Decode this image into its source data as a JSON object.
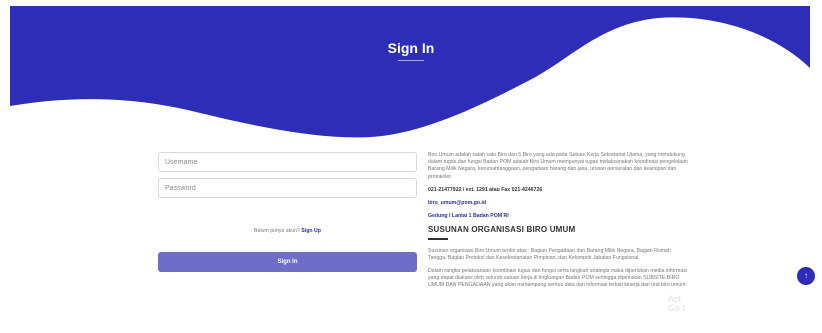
{
  "hero": {
    "title": "Sign In",
    "color": "#2d2db8"
  },
  "login_form": {
    "username_placeholder": "Username",
    "password_placeholder": "Password",
    "signup_prompt": "Belum punya akun?",
    "signup_link": "Sign Up",
    "signin_button": "Sign In",
    "button_color": "#6e6ec9"
  },
  "info": {
    "about": "Biro Umum adalah salah satu Biro dari 5 Biro yang ada pada Satuan Kerja Sekretariat Utama, yang mendukung dalam tugas dan fungsi Badan POM adalah Biro Umum mempunyai tugas melaksanakan koordinasi pengelolaan Barang Milik Negara, kerumahtanggaan, pengadaan barang dan jasa, urusan persuratan dan kearsipan dan protokoler.",
    "phone": "021-21477922 / ext. 1291 atau Fax 021-4246726",
    "email": "biro_umum@pom.go.id",
    "address": "Gedung I Lantai 1 Badan POM RI",
    "org_heading": "SUSUNAN ORGANISASI BIRO UMUM",
    "org_text": "Susunan organisasi Biro Umum terdiri atas : Bagian Pengadaan dan Barang Milik Negara, Bagian Rumah Tangga, Bagian Protokol dan Kesekretariatan Pimpinan, dan Kelompok Jabatan Fungsional.",
    "coord_text": "Dalam rangka pelaksanaan koordinasi tugas dan fungsi serta langkah strategis maka diperlukan media informasi yang dapat diakses oleh seluruh satuan kerja di lingkungan Badan POM sehingga diperlukan SUBSITE BIRO UMUM DAN PENGADAAN yang akan menampung semua data dan informasi terkait kinerja dari unit biro umum."
  },
  "scroll_top_icon": "arrow-up-icon",
  "watermark": "Act\nGo t"
}
